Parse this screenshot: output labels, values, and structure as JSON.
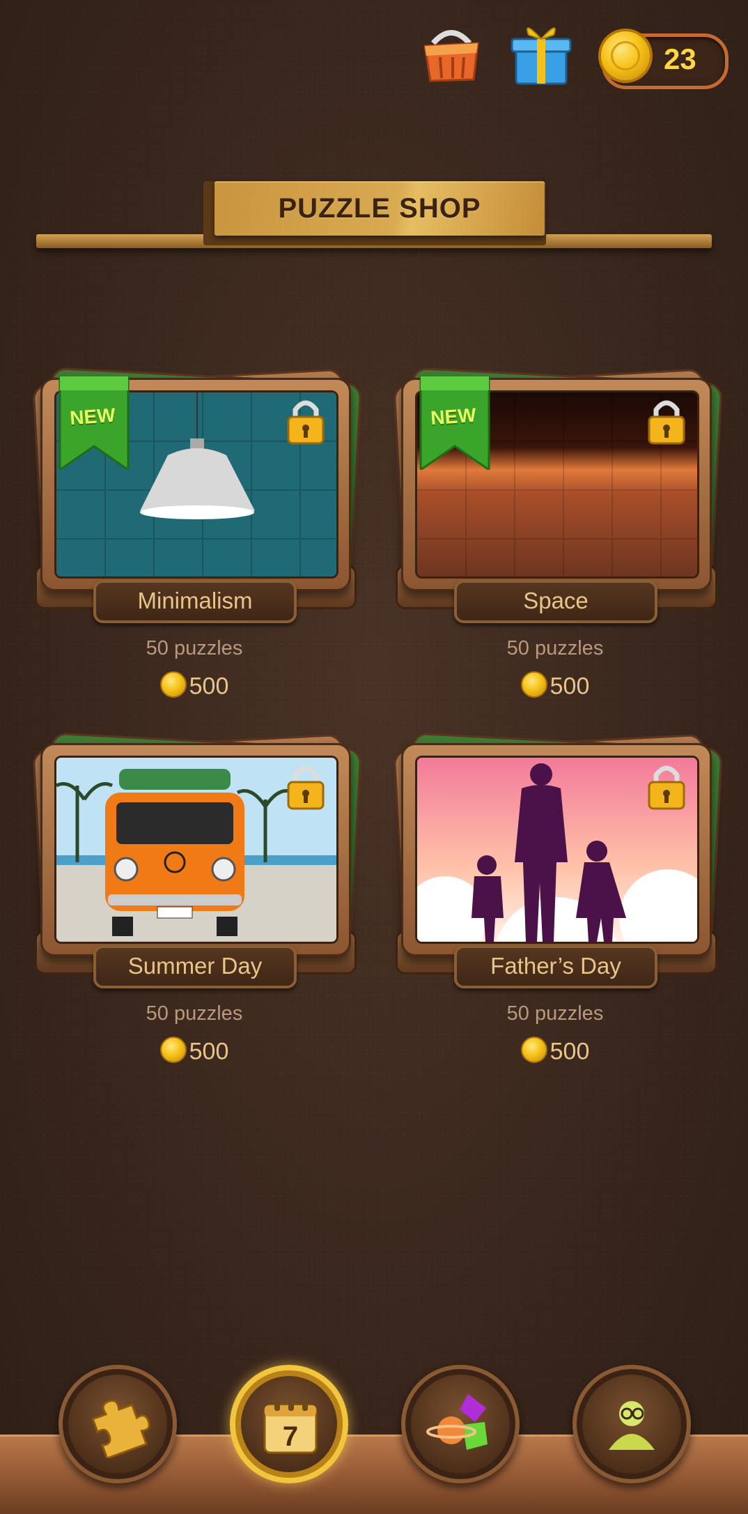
{
  "header": {
    "coin_balance": "23"
  },
  "title": "PUZZLE SHOP",
  "packs": [
    {
      "name": "Minimalism",
      "count": "50 puzzles",
      "price": "500",
      "badge": "NEW",
      "locked": true
    },
    {
      "name": "Space",
      "count": "50 puzzles",
      "price": "500",
      "badge": "NEW",
      "locked": true
    },
    {
      "name": "Summer Day",
      "count": "50 puzzles",
      "price": "500",
      "badge": "",
      "locked": true
    },
    {
      "name": "Father’s Day",
      "count": "50 puzzles",
      "price": "500",
      "badge": "",
      "locked": true
    }
  ],
  "nav": {
    "items": [
      {
        "icon": "puzzle-piece-icon"
      },
      {
        "icon": "calendar-icon",
        "label": "7",
        "active": true
      },
      {
        "icon": "planet-shapes-icon"
      },
      {
        "icon": "avatar-icon"
      }
    ]
  },
  "colors": {
    "background": "#3a271d",
    "accent_gold": "#f1c53c",
    "label_text": "#e9c58a",
    "new_badge": "#3aa52a"
  }
}
